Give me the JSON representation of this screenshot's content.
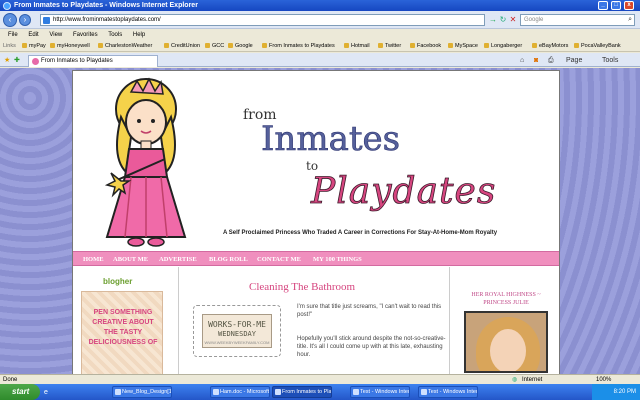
{
  "window": {
    "title": "From Inmates to Playdates - Windows Internet Explorer",
    "minimize": "_",
    "maximize": "□",
    "close": "x"
  },
  "address_bar": {
    "url": "http://www.frominmatestoplaydates.com/",
    "search_placeholder": "Google"
  },
  "menu": [
    "File",
    "Edit",
    "View",
    "Favorites",
    "Tools",
    "Help"
  ],
  "links_bar": {
    "label": "Links",
    "items": [
      "myPay",
      "myHoneywell",
      "CharlestonWeather",
      "CreditUnion",
      "GCC",
      "Google",
      "From Inmates to Playdates",
      "Hotmail",
      "Twitter",
      "Facebook",
      "MySpace",
      "Longaberger",
      "eBayMotors",
      "PocaValleyBank"
    ]
  },
  "tab": {
    "label": "From Inmates to Playdates"
  },
  "toolbar": {
    "page": "Page",
    "tools": "Tools"
  },
  "blog": {
    "title_from": "from",
    "title_inmates": "Inmates",
    "title_to": "to",
    "title_playdates": "Playdates",
    "tagline": "A Self Proclaimed Princess Who Traded A Career in Corrections For Stay-At-Home-Mom Royalty",
    "nav": [
      "HOME",
      "ABOUT ME",
      "ADVERTISE",
      "BLOG ROLL",
      "CONTACT ME",
      "MY 100 THINGS"
    ],
    "sidebar_left": {
      "blogher": "blogher",
      "ad_lines": [
        "PEN SOMETHING",
        "CREATIVE ABOUT",
        "THE TASTY",
        "DELICIOUSNESS OF"
      ]
    },
    "post": {
      "title": "Cleaning The Bathroom",
      "badge_line1": "WORKS-FOR-ME",
      "badge_line2": "WEDNESDAY",
      "badge_line3": "WWW.WEEKBYWEEKFAMILY.COM",
      "paragraphs": [
        "I'm sure that title just screams, \"I can't wait to read this post!\"",
        "Hopefully you'll stick around despite the not-so-creative-title. It's all I could come up with at this late, exhausting hour."
      ]
    },
    "sidebar_right": {
      "heading": "HER ROYAL HIGHNESS ~ PRINCESS JULIE"
    }
  },
  "status": {
    "left": "Done",
    "zone": "Internet",
    "zoom": "100%"
  },
  "taskbar": {
    "start": "start",
    "tasks": [
      "New_Blog_Design[1]...",
      "Ham.doc - Microsoft ...",
      "From Inmates to Play...",
      "Test - Windows Inter...",
      "Test - Windows Inter..."
    ],
    "clock": "8:20 PM"
  }
}
